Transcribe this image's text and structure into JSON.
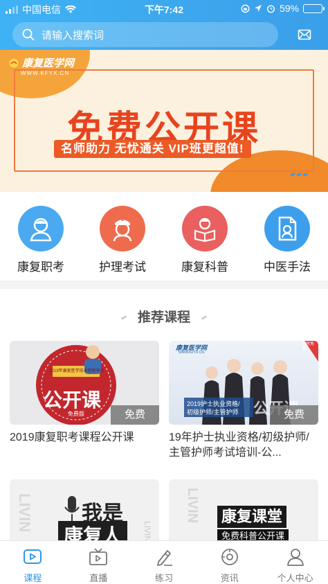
{
  "status_bar": {
    "carrier": "中国电信",
    "time": "下午7:42",
    "battery": "59%",
    "battery_level": 0.59
  },
  "search": {
    "placeholder": "请输入搜索词"
  },
  "banner": {
    "logo_name": "康复医学网",
    "logo_url": "WWW.KFYX.CN",
    "title": "免费公开课",
    "subtitle": "名师助力  无忧通关  VIP班更超值!"
  },
  "categories": [
    {
      "label": "康复职考",
      "color": "#4aa9f0"
    },
    {
      "label": "护理考试",
      "color": "#ee6c4d"
    },
    {
      "label": "康复科普",
      "color": "#ea5f5f"
    },
    {
      "label": "中医手法",
      "color": "#3d9fec"
    }
  ],
  "section": {
    "title": "推荐课程"
  },
  "courses": [
    {
      "title": "2019康复职考课程公开课",
      "tag": "免费",
      "thumb_caption_top": "2019年康复医学技术职称考试",
      "thumb_caption_mid": "公开课",
      "thumb_caption_small": "免费版"
    },
    {
      "title": "19年护士执业资格/初级护师/主管护师考试培训-公...",
      "tag": "免费",
      "thumb_logo": "康复医学网",
      "thumb_logo_url": "WWW.KFYX.CN",
      "thumb_caption_line1": "2019护士执业资格/",
      "thumb_caption_line2": "初级护师/主管护师",
      "thumb_overlay": "公开课",
      "thumb_badge": "限时免费"
    },
    {
      "thumb_main_1": "我是",
      "thumb_main_2": "康复人",
      "thumb_side": "LIVIN"
    },
    {
      "thumb_main": "康复课堂",
      "thumb_sub": "免费科普公开课",
      "thumb_side": "LIVIN"
    }
  ],
  "tabbar": [
    {
      "label": "课程",
      "icon": "course-icon",
      "active": true
    },
    {
      "label": "直播",
      "icon": "tv-icon",
      "active": false
    },
    {
      "label": "练习",
      "icon": "pencil-icon",
      "active": false
    },
    {
      "label": "资讯",
      "icon": "news-icon",
      "active": false
    },
    {
      "label": "个人中心",
      "icon": "user-icon",
      "active": false
    }
  ],
  "colors": {
    "accent": "#2f97e6",
    "header_start": "#3fb2f5",
    "banner_red": "#e8431e"
  }
}
